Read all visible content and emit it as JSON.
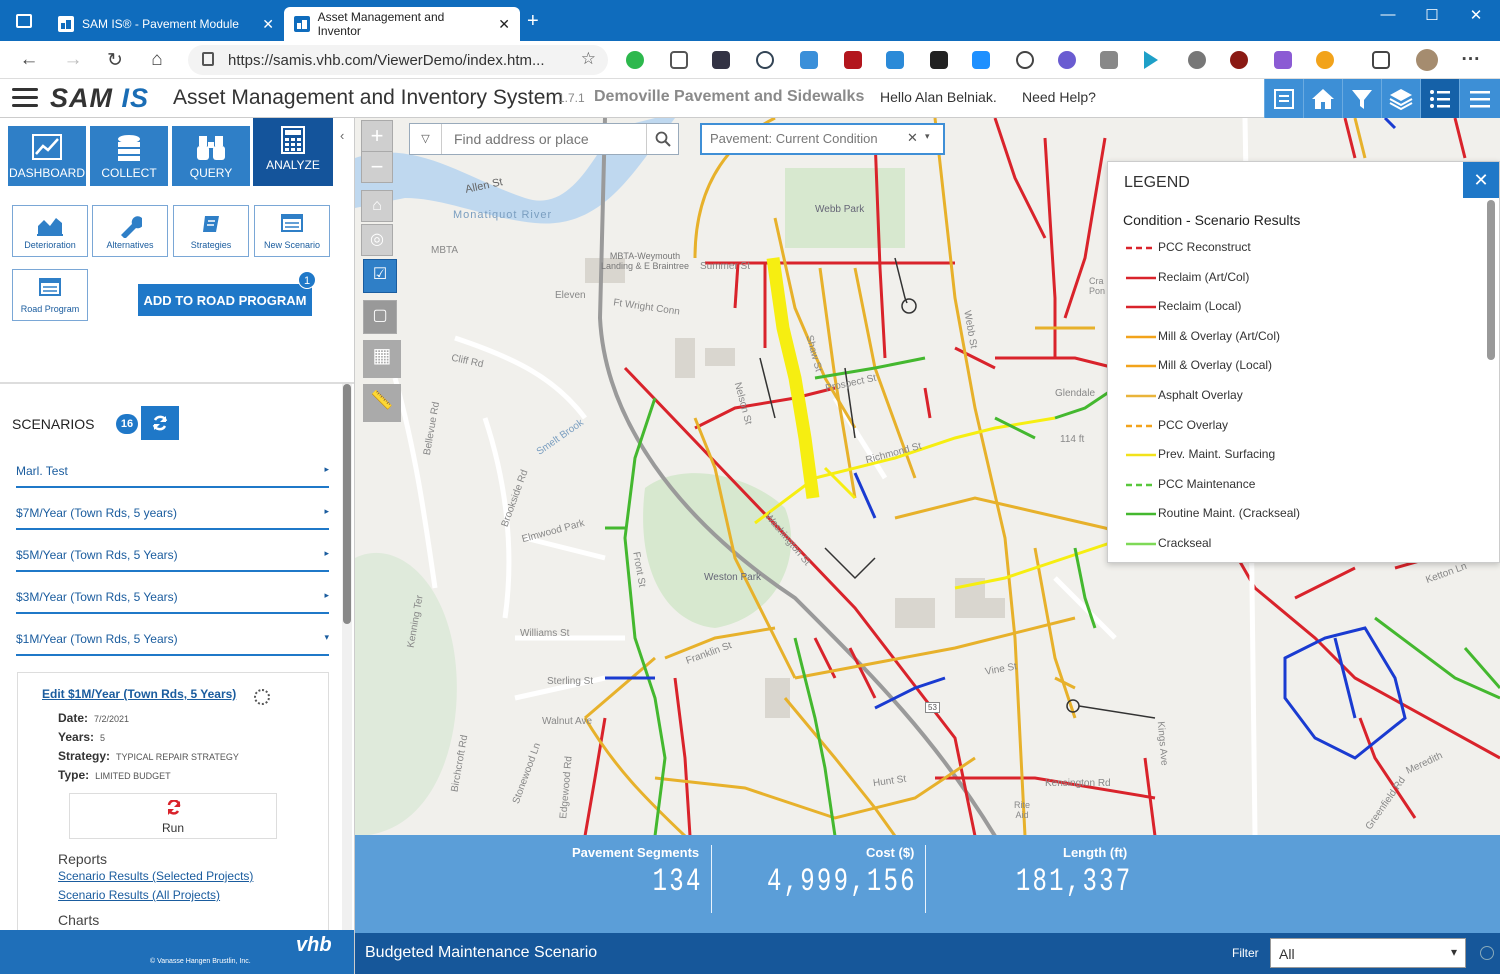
{
  "browser": {
    "tabs": [
      {
        "title": "SAM IS® - Pavement Module",
        "active": false
      },
      {
        "title": "Asset Management and Inventor",
        "active": true
      }
    ],
    "new_tab": "+",
    "url": "https://samis.vhb.com/ViewerDemo/index.htm...",
    "window_controls": [
      "—",
      "☐",
      "✕"
    ]
  },
  "header": {
    "logo_sam": "SAM",
    "logo_is": "IS",
    "title": "Asset Management and Inventory System",
    "version": "1.7.1",
    "subtitle": "Demoville Pavement and Sidewalks",
    "greeting": "Hello Alan Belniak.",
    "help": "Need Help?",
    "tools": [
      "list-check-icon",
      "home-icon",
      "filter-icon",
      "layers-icon",
      "legend-list-icon",
      "menu-icon"
    ]
  },
  "modules": [
    {
      "label": "DASHBOARD",
      "icon": "chart-icon",
      "active": false
    },
    {
      "label": "COLLECT",
      "icon": "database-icon",
      "active": false
    },
    {
      "label": "QUERY",
      "icon": "binoculars-icon",
      "active": false
    },
    {
      "label": "ANALYZE",
      "icon": "calculator-icon",
      "active": true
    }
  ],
  "analyze_tools": [
    {
      "label": "Deterioration",
      "icon": "area-chart-icon"
    },
    {
      "label": "Alternatives",
      "icon": "wrench-icon"
    },
    {
      "label": "Strategies",
      "icon": "book-icon"
    },
    {
      "label": "New Scenario",
      "icon": "card-icon"
    },
    {
      "label": "Road Program",
      "icon": "list-card-icon"
    }
  ],
  "add_road_program": {
    "label": "ADD TO ROAD PROGRAM",
    "badge": "1"
  },
  "scenarios": {
    "title": "SCENARIOS",
    "count": "16",
    "items": [
      {
        "label": "Marl. Test",
        "arrow": "▸"
      },
      {
        "label": "$7M/Year (Town Rds, 5 years)",
        "arrow": "▸"
      },
      {
        "label": "$5M/Year (Town Rds, 5 Years)",
        "arrow": "▸"
      },
      {
        "label": "$3M/Year (Town Rds, 5 Years)",
        "arrow": "▸"
      },
      {
        "label": "$1M/Year (Town Rds, 5 Years)",
        "arrow": "▾"
      }
    ],
    "card": {
      "edit_link": "Edit $1M/Year (Town Rds, 5 Years)",
      "date_label": "Date:",
      "date": "7/2/2021",
      "years_label": "Years:",
      "years": "5",
      "strategy_label": "Strategy:",
      "strategy": "TYPICAL REPAIR STRATEGY",
      "type_label": "Type:",
      "type": "LIMITED BUDGET",
      "run_label": "Run",
      "reports_label": "Reports",
      "report_links": [
        "Scenario Results (Selected Projects)",
        "Scenario Results (All Projects)"
      ],
      "charts_label": "Charts"
    }
  },
  "footer": {
    "copyright": "© Vanasse Hangen Brustlin, Inc.",
    "vhb": "vhb"
  },
  "map": {
    "search_placeholder": "Find address or place",
    "layer": "Pavement: Current Condition",
    "layer_clear": "✕",
    "layer_arrow": "▾",
    "controls": [
      "+",
      "−"
    ],
    "labels": [
      "Allen St",
      "Monatiquot River",
      "MBTA",
      "MBTA-Weymouth Landing & E Braintree",
      "Eleven",
      "Ft Wright Conn",
      "Cliff Rd",
      "Webb Park",
      "Smelt Brook",
      "Richmond St",
      "Elmwood Park",
      "Weston Park",
      "Williams St",
      "Sterling St",
      "Walnut Ave",
      "Hunt St",
      "Vine St",
      "Kensington Rd",
      "Rite Aid",
      "Bellevue Rd",
      "Brookside Rd",
      "Kenning Ter",
      "Birchcroft Rd",
      "Stonewood Ln",
      "Edgewood Rd",
      "Franklin St",
      "Washington St",
      "Summer St",
      "Glendale",
      "114 ft",
      "53",
      "Nelson St",
      "Shaw St",
      "Front St",
      "Prospect St",
      "Kings Ave",
      "Webb St",
      "Cra Pon",
      "Meredith",
      "Ketton Ln",
      "Greenfield Rd"
    ]
  },
  "legend": {
    "title": "LEGEND",
    "close": "✕",
    "subtitle": "Condition - Scenario Results",
    "items": [
      {
        "label": "PCC Reconstruct",
        "color": "#d9232b",
        "dash": true
      },
      {
        "label": "Reclaim (Art/Col)",
        "color": "#d9232b",
        "dash": false
      },
      {
        "label": "Reclaim (Local)",
        "color": "#d9232b",
        "dash": false
      },
      {
        "label": "Mill & Overlay (Art/Col)",
        "color": "#f2a31b",
        "dash": false
      },
      {
        "label": "Mill & Overlay (Local)",
        "color": "#f2a31b",
        "dash": false
      },
      {
        "label": "Asphalt Overlay",
        "color": "#e9b43a",
        "dash": false
      },
      {
        "label": "PCC Overlay",
        "color": "#f2a31b",
        "dash": true
      },
      {
        "label": "Prev. Maint. Surfacing",
        "color": "#f2e21b",
        "dash": false
      },
      {
        "label": "PCC Maintenance",
        "color": "#58c73b",
        "dash": true
      },
      {
        "label": "Routine Maint. (Crackseal)",
        "color": "#44b82f",
        "dash": false
      },
      {
        "label": "Crackseal",
        "color": "#7ed957",
        "dash": false
      }
    ]
  },
  "stats": {
    "segments_label": "Pavement Segments",
    "segments": "134",
    "cost_label": "Cost ($)",
    "cost": "4,999,156",
    "length_label": "Length (ft)",
    "length": "181,337"
  },
  "bottom": {
    "title": "Budgeted Maintenance Scenario",
    "filter_label": "Filter",
    "filter_value": "All",
    "filter_arrow": "▾"
  }
}
